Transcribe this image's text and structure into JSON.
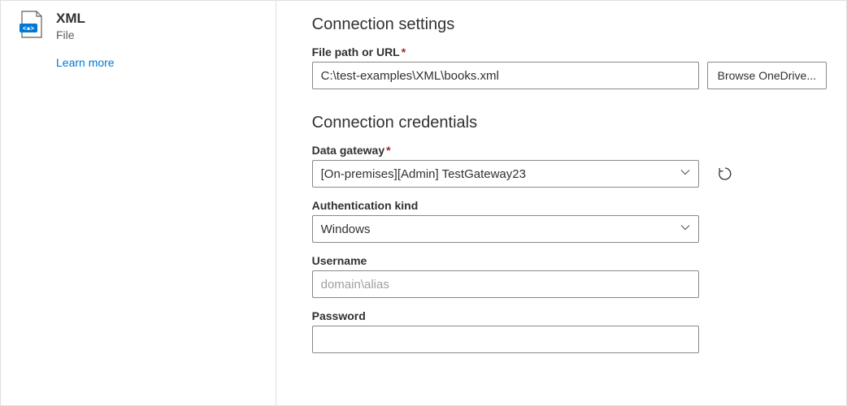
{
  "sidebar": {
    "title": "XML",
    "subtitle": "File",
    "learn_more": "Learn more"
  },
  "settings": {
    "heading": "Connection settings",
    "file_path_label": "File path or URL",
    "file_path_value": "C:\\test-examples\\XML\\books.xml",
    "browse_label": "Browse OneDrive..."
  },
  "credentials": {
    "heading": "Connection credentials",
    "gateway_label": "Data gateway",
    "gateway_value": "[On-premises][Admin] TestGateway23",
    "auth_label": "Authentication kind",
    "auth_value": "Windows",
    "username_label": "Username",
    "username_placeholder": "domain\\alias",
    "username_value": "",
    "password_label": "Password",
    "password_value": ""
  }
}
